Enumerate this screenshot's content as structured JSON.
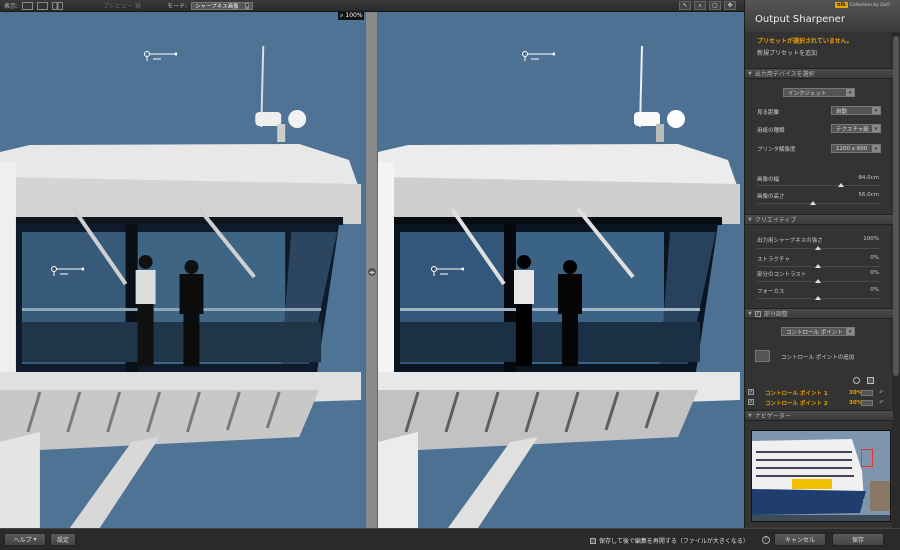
{
  "topbar": {
    "view_label": "表示:",
    "preview_label": "プレビュー 鏡",
    "mode_label": "モード:",
    "mode_value": "シャープネス画像",
    "zoom": "100%"
  },
  "panel": {
    "title": "Output Sharpener",
    "logo_box": "nik",
    "logo_text": "Collection by DxO",
    "preset_warning": "プリセットが選択されていません。",
    "preset_add": "新規プリセットを追加",
    "sections": {
      "device": "出力用デバイスを選択",
      "creative": "クリエイティブ",
      "selective": "部分調整",
      "navigator": "ナビゲーター"
    },
    "device_value": "インクジェット",
    "viewing_distance_label": "見る距離",
    "viewing_distance_value": "自動",
    "paper_type_label": "用紙の種類",
    "paper_type_value": "テクスチャ紙",
    "printer_res_label": "プリンタ解像度",
    "printer_res_value": "1200 x 600",
    "image_width_label": "画像の幅",
    "image_width_value": "84.0cm",
    "image_height_label": "画像の高さ",
    "image_height_value": "56.0cm",
    "creative_sliders": [
      {
        "label": "出力用シャープネスの強さ",
        "value": "100%"
      },
      {
        "label": "ストラクチャ",
        "value": "0%"
      },
      {
        "label": "部分のコントラスト",
        "value": "0%"
      },
      {
        "label": "フォーカス",
        "value": "0%"
      }
    ],
    "control_point_dropdown": "コントロール ポイント",
    "add_control_point": "コントロール ポイントの追加",
    "control_points": [
      {
        "name": "コントロール ポイント 1",
        "value": "30%"
      },
      {
        "name": "コントロール ポイント 2",
        "value": "30%"
      }
    ]
  },
  "bottombar": {
    "help": "ヘルプ",
    "settings": "設定",
    "save_hint": "保存して後で編集を再開する（ファイルが大きくなる）",
    "cancel": "キャンセル",
    "save": "保存"
  },
  "colors": {
    "accent": "#e8a000",
    "sky": "#4f7395"
  },
  "icons": [
    "single-view-icon",
    "split-view-icon",
    "dual-view-icon",
    "hand-tool-icon",
    "zoom-tool-icon",
    "loupe-icon",
    "fit-icon",
    "chevron-down-icon",
    "checkbox-icon",
    "help-icon",
    "split-handle-icon"
  ]
}
